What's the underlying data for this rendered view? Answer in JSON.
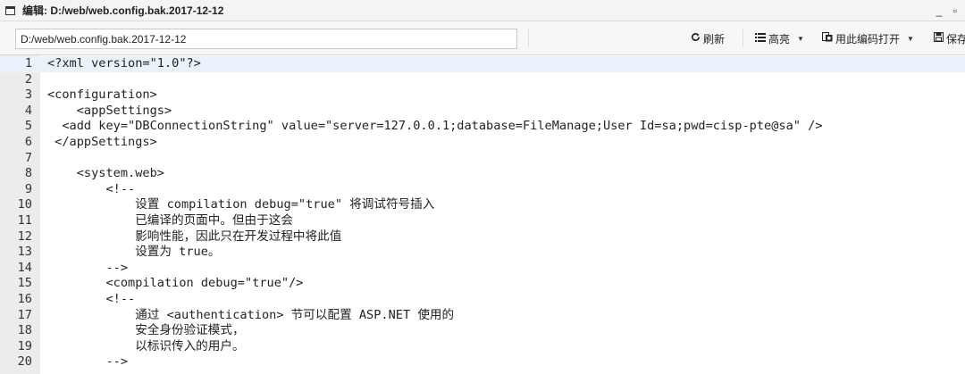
{
  "window": {
    "title": "编辑: D:/web/web.config.bak.2017-12-12",
    "minimize": "_",
    "restore": "▫"
  },
  "toolbar": {
    "path_value": "D:/web/web.config.bak.2017-12-12",
    "refresh_icon": "refresh-icon",
    "refresh_label": "刷新",
    "highlight_icon": "list-icon",
    "highlight_label": "高亮",
    "open_with_encoding_icon": "encoding-icon",
    "open_with_encoding_label": "用此编码打开",
    "save_icon": "save-icon",
    "save_label": "保存"
  },
  "editor": {
    "lines": [
      {
        "num": "1",
        "text": "<?xml version=\"1.0\"?>"
      },
      {
        "num": "2",
        "text": ""
      },
      {
        "num": "3",
        "text": "<configuration>"
      },
      {
        "num": "4",
        "text": "    <appSettings>"
      },
      {
        "num": "5",
        "text": "  <add key=\"DBConnectionString\" value=\"server=127.0.0.1;database=FileManage;User Id=sa;pwd=cisp-pte@sa\" />"
      },
      {
        "num": "6",
        "text": " </appSettings>"
      },
      {
        "num": "7",
        "text": ""
      },
      {
        "num": "8",
        "text": "    <system.web>"
      },
      {
        "num": "9",
        "text": "        <!--"
      },
      {
        "num": "10",
        "text": "            设置 compilation debug=\"true\" 将调试符号插入"
      },
      {
        "num": "11",
        "text": "            已编译的页面中。但由于这会"
      },
      {
        "num": "12",
        "text": "            影响性能，因此只在开发过程中将此值"
      },
      {
        "num": "13",
        "text": "            设置为 true。"
      },
      {
        "num": "14",
        "text": "        -->"
      },
      {
        "num": "15",
        "text": "        <compilation debug=\"true\"/>"
      },
      {
        "num": "16",
        "text": "        <!--"
      },
      {
        "num": "17",
        "text": "            通过 <authentication> 节可以配置 ASP.NET 使用的"
      },
      {
        "num": "18",
        "text": "            安全身份验证模式，"
      },
      {
        "num": "19",
        "text": "            以标识传入的用户。"
      },
      {
        "num": "20",
        "text": "        -->"
      }
    ]
  }
}
